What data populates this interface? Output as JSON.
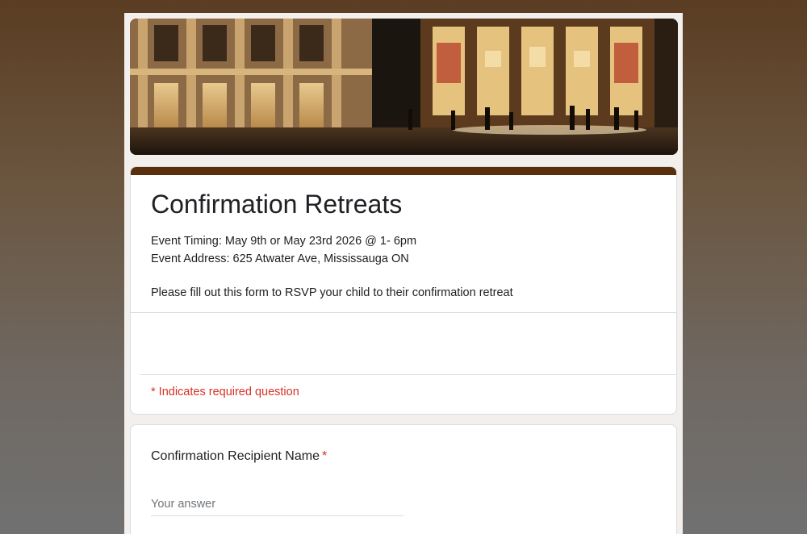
{
  "form": {
    "title": "Confirmation Retreats",
    "description_line1": "Event Timing: May 9th or May 23rd 2026 @ 1- 6pm",
    "description_line2": "Event Address: 625 Atwater Ave, Mississauga ON",
    "description_line3": "Please fill out this form to RSVP your child to their confirmation retreat",
    "required_note": "* Indicates required question"
  },
  "questions": [
    {
      "label": "Confirmation Recipient Name",
      "required_marker": "*",
      "placeholder": "Your answer"
    }
  ],
  "colors": {
    "accent": "#5a2f0c",
    "required": "#d93025",
    "background_top": "#5a3d22",
    "background_bottom": "#717171"
  }
}
